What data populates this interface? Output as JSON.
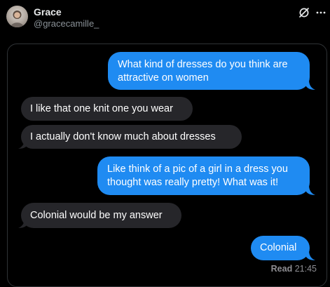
{
  "author": {
    "name": "Grace",
    "handle": "@gracecamille_"
  },
  "icons": {
    "grok": "grok-icon",
    "more": "more-icon"
  },
  "colors": {
    "sent_bubble": "#1f8bf2",
    "received_bubble": "#26262a",
    "background": "#000000"
  },
  "messages": [
    {
      "from": "me",
      "lines": [
        "What kind of dresses do you think are",
        "attractive on women"
      ]
    },
    {
      "from": "them",
      "lines": [
        "I like that one knit one you wear"
      ]
    },
    {
      "from": "them",
      "lines": [
        "I actually don't know much about dresses"
      ]
    },
    {
      "from": "me",
      "lines": [
        "Like think of a pic of a girl in a dress you",
        "thought was really pretty! What was it!"
      ]
    },
    {
      "from": "them",
      "lines": [
        "Colonial would be my answer"
      ]
    },
    {
      "from": "me",
      "lines": [
        "Colonial"
      ]
    }
  ],
  "receipt": {
    "label": "Read",
    "time": "21:45"
  }
}
